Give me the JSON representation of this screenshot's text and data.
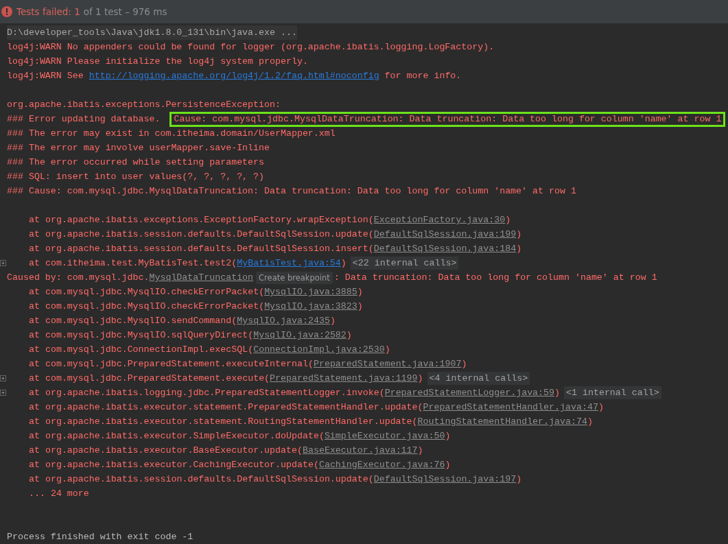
{
  "header": {
    "status": "Tests failed: 1",
    "summary": "of 1 test – 976 ms"
  },
  "console": [
    {
      "kind": "command",
      "segments": [
        {
          "kind": "text",
          "text": "D:\\developer_tools\\Java\\jdk1.8.0_131\\bin\\java.exe ..."
        }
      ]
    },
    {
      "kind": "error",
      "segments": [
        {
          "kind": "text",
          "text": "log4j:WARN No appenders could be found for logger (org.apache.ibatis.logging.LogFactory)."
        }
      ]
    },
    {
      "kind": "error",
      "segments": [
        {
          "kind": "text",
          "text": "log4j:WARN Please initialize the log4j system properly."
        }
      ]
    },
    {
      "kind": "error",
      "segments": [
        {
          "kind": "text",
          "text": "log4j:WARN See "
        },
        {
          "kind": "link",
          "text": "http://logging.apache.org/log4j/1.2/faq.html#noconfig"
        },
        {
          "kind": "text",
          "text": " for more info."
        }
      ]
    },
    {
      "kind": "blank"
    },
    {
      "kind": "error",
      "segments": [
        {
          "kind": "text",
          "text": "org.apache.ibatis.exceptions.PersistenceException:"
        }
      ]
    },
    {
      "kind": "error",
      "segments": [
        {
          "kind": "text",
          "text": "### Error updating database."
        },
        {
          "kind": "boxed",
          "text": "Cause: com.mysql.jdbc.MysqlDataTruncation: Data truncation: Data too long for column 'name' at row 1"
        }
      ]
    },
    {
      "kind": "error",
      "segments": [
        {
          "kind": "text",
          "text": "### The error may exist in com.itheima.domain/UserMapper.xml"
        }
      ]
    },
    {
      "kind": "error",
      "segments": [
        {
          "kind": "text",
          "text": "### The error may involve userMapper.save-Inline"
        }
      ]
    },
    {
      "kind": "error",
      "segments": [
        {
          "kind": "text",
          "text": "### The error occurred while setting parameters"
        }
      ]
    },
    {
      "kind": "error",
      "segments": [
        {
          "kind": "text",
          "text": "### SQL: insert into user values(?, ?, ?, ?, ?)"
        }
      ]
    },
    {
      "kind": "error",
      "segments": [
        {
          "kind": "text",
          "text": "### Cause: com.mysql.jdbc.MysqlDataTruncation: Data truncation: Data too long for column 'name' at row 1"
        }
      ]
    },
    {
      "kind": "blank"
    },
    {
      "kind": "frame",
      "expandable": false,
      "segments": [
        {
          "kind": "text",
          "text": "at org.apache.ibatis.exceptions.ExceptionFactory.wrapException("
        },
        {
          "kind": "source",
          "text": "ExceptionFactory.java:30"
        },
        {
          "kind": "text",
          "text": ")"
        }
      ]
    },
    {
      "kind": "frame",
      "expandable": false,
      "segments": [
        {
          "kind": "text",
          "text": "at org.apache.ibatis.session.defaults.DefaultSqlSession.update("
        },
        {
          "kind": "source",
          "text": "DefaultSqlSession.java:199"
        },
        {
          "kind": "text",
          "text": ")"
        }
      ]
    },
    {
      "kind": "frame",
      "expandable": false,
      "segments": [
        {
          "kind": "text",
          "text": "at org.apache.ibatis.session.defaults.DefaultSqlSession.insert("
        },
        {
          "kind": "source",
          "text": "DefaultSqlSession.java:184"
        },
        {
          "kind": "text",
          "text": ")"
        }
      ]
    },
    {
      "kind": "frame",
      "expandable": true,
      "segments": [
        {
          "kind": "text",
          "text": "at com.itheima.test.MyBatisTest.test2("
        },
        {
          "kind": "link",
          "text": "MyBatisTest.java:54"
        },
        {
          "kind": "text",
          "text": ")"
        },
        {
          "kind": "fold",
          "text": "<22 internal calls>"
        }
      ]
    },
    {
      "kind": "error",
      "segments": [
        {
          "kind": "text",
          "text": "Caused by: com.mysql.jdbc."
        },
        {
          "kind": "source",
          "text": "MysqlDataTruncation"
        },
        {
          "kind": "hint",
          "text": "Create breakpoint"
        },
        {
          "kind": "text",
          "text": ": Data truncation: Data too long for column 'name' at row 1"
        }
      ]
    },
    {
      "kind": "frame",
      "expandable": false,
      "segments": [
        {
          "kind": "text",
          "text": "at com.mysql.jdbc.MysqlIO.checkErrorPacket("
        },
        {
          "kind": "source",
          "text": "MysqlIO.java:3885"
        },
        {
          "kind": "text",
          "text": ")"
        }
      ]
    },
    {
      "kind": "frame",
      "expandable": false,
      "segments": [
        {
          "kind": "text",
          "text": "at com.mysql.jdbc.MysqlIO.checkErrorPacket("
        },
        {
          "kind": "source",
          "text": "MysqlIO.java:3823"
        },
        {
          "kind": "text",
          "text": ")"
        }
      ]
    },
    {
      "kind": "frame",
      "expandable": false,
      "segments": [
        {
          "kind": "text",
          "text": "at com.mysql.jdbc.MysqlIO.sendCommand("
        },
        {
          "kind": "source",
          "text": "MysqlIO.java:2435"
        },
        {
          "kind": "text",
          "text": ")"
        }
      ]
    },
    {
      "kind": "frame",
      "expandable": false,
      "segments": [
        {
          "kind": "text",
          "text": "at com.mysql.jdbc.MysqlIO.sqlQueryDirect("
        },
        {
          "kind": "source",
          "text": "MysqlIO.java:2582"
        },
        {
          "kind": "text",
          "text": ")"
        }
      ]
    },
    {
      "kind": "frame",
      "expandable": false,
      "segments": [
        {
          "kind": "text",
          "text": "at com.mysql.jdbc.ConnectionImpl.execSQL("
        },
        {
          "kind": "source",
          "text": "ConnectionImpl.java:2530"
        },
        {
          "kind": "text",
          "text": ")"
        }
      ]
    },
    {
      "kind": "frame",
      "expandable": false,
      "segments": [
        {
          "kind": "text",
          "text": "at com.mysql.jdbc.PreparedStatement.executeInternal("
        },
        {
          "kind": "source",
          "text": "PreparedStatement.java:1907"
        },
        {
          "kind": "text",
          "text": ")"
        }
      ]
    },
    {
      "kind": "frame",
      "expandable": true,
      "segments": [
        {
          "kind": "text",
          "text": "at com.mysql.jdbc.PreparedStatement.execute("
        },
        {
          "kind": "source",
          "text": "PreparedStatement.java:1199"
        },
        {
          "kind": "text",
          "text": ")"
        },
        {
          "kind": "fold",
          "text": "<4 internal calls>"
        }
      ]
    },
    {
      "kind": "frame",
      "expandable": true,
      "segments": [
        {
          "kind": "text",
          "text": "at org.apache.ibatis.logging.jdbc.PreparedStatementLogger.invoke("
        },
        {
          "kind": "source",
          "text": "PreparedStatementLogger.java:59"
        },
        {
          "kind": "text",
          "text": ")"
        },
        {
          "kind": "fold",
          "text": "<1 internal call>"
        }
      ]
    },
    {
      "kind": "frame",
      "expandable": false,
      "segments": [
        {
          "kind": "text",
          "text": "at org.apache.ibatis.executor.statement.PreparedStatementHandler.update("
        },
        {
          "kind": "source",
          "text": "PreparedStatementHandler.java:47"
        },
        {
          "kind": "text",
          "text": ")"
        }
      ]
    },
    {
      "kind": "frame",
      "expandable": false,
      "segments": [
        {
          "kind": "text",
          "text": "at org.apache.ibatis.executor.statement.RoutingStatementHandler.update("
        },
        {
          "kind": "source",
          "text": "RoutingStatementHandler.java:74"
        },
        {
          "kind": "text",
          "text": ")"
        }
      ]
    },
    {
      "kind": "frame",
      "expandable": false,
      "segments": [
        {
          "kind": "text",
          "text": "at org.apache.ibatis.executor.SimpleExecutor.doUpdate("
        },
        {
          "kind": "source",
          "text": "SimpleExecutor.java:50"
        },
        {
          "kind": "text",
          "text": ")"
        }
      ]
    },
    {
      "kind": "frame",
      "expandable": false,
      "segments": [
        {
          "kind": "text",
          "text": "at org.apache.ibatis.executor.BaseExecutor.update("
        },
        {
          "kind": "source",
          "text": "BaseExecutor.java:117"
        },
        {
          "kind": "text",
          "text": ")"
        }
      ]
    },
    {
      "kind": "frame",
      "expandable": false,
      "segments": [
        {
          "kind": "text",
          "text": "at org.apache.ibatis.executor.CachingExecutor.update("
        },
        {
          "kind": "source",
          "text": "CachingExecutor.java:76"
        },
        {
          "kind": "text",
          "text": ")"
        }
      ]
    },
    {
      "kind": "frame",
      "expandable": false,
      "segments": [
        {
          "kind": "text",
          "text": "at org.apache.ibatis.session.defaults.DefaultSqlSession.update("
        },
        {
          "kind": "source",
          "text": "DefaultSqlSession.java:197"
        },
        {
          "kind": "text",
          "text": ")"
        }
      ]
    },
    {
      "kind": "frame",
      "expandable": false,
      "segments": [
        {
          "kind": "text",
          "text": "... 24 more"
        }
      ]
    },
    {
      "kind": "blank"
    },
    {
      "kind": "blank"
    },
    {
      "kind": "exit",
      "segments": [
        {
          "kind": "text",
          "text": "Process finished with exit code -1"
        }
      ]
    }
  ]
}
